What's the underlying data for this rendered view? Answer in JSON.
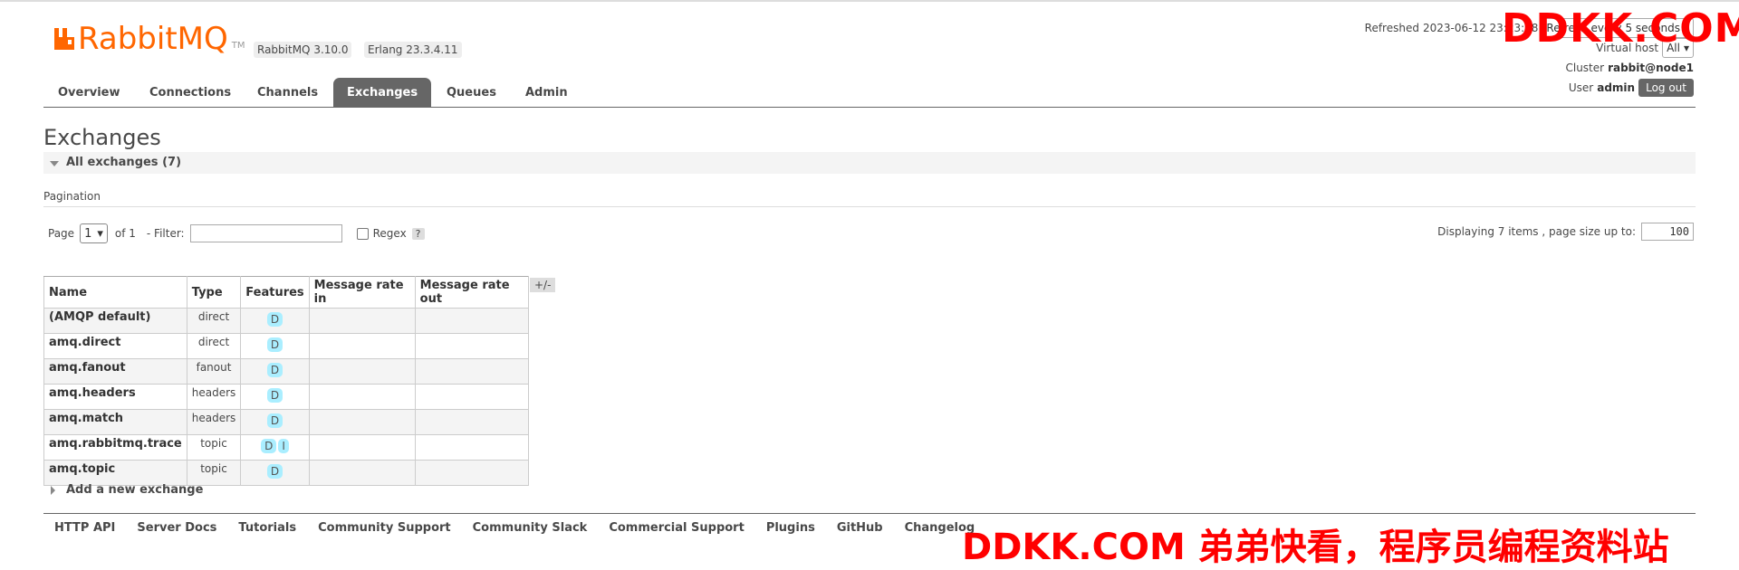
{
  "app": {
    "logo_text": "RabbitMQ",
    "logo_tm": "TM",
    "version_rabbit": "RabbitMQ 3.10.0",
    "version_erlang": "Erlang 23.3.4.11",
    "brand_color": "#ff6600"
  },
  "status": {
    "refreshed_label": "Refreshed",
    "refreshed_time": "2023-06-12 23:23:28",
    "refresh_every_text": "Refresh every",
    "refresh_interval": "5 seconds",
    "vhost_label": "Virtual host",
    "vhost_value": "All",
    "cluster_label": "Cluster",
    "cluster_value": "rabbit@node1",
    "user_label": "User",
    "user_value": "admin",
    "logout_label": "Log out"
  },
  "nav": {
    "tabs": [
      "Overview",
      "Connections",
      "Channels",
      "Exchanges",
      "Queues",
      "Admin"
    ],
    "active": "Exchanges"
  },
  "page": {
    "title": "Exchanges",
    "section_label": "All exchanges (7)"
  },
  "pagination": {
    "label": "Pagination",
    "page_label": "Page",
    "page_value": "1",
    "of_text": "of 1",
    "filter_label": "- Filter:",
    "filter_value": "",
    "regex_label": "Regex",
    "help": "?",
    "display_text": "Displaying 7 items , page size up to:",
    "page_size": "100"
  },
  "table": {
    "columns": [
      "Name",
      "Type",
      "Features",
      "Message rate in",
      "Message rate out"
    ],
    "toggle": "+/-",
    "rows": [
      {
        "name": "(AMQP default)",
        "type": "direct",
        "features": [
          "D"
        ],
        "rate_in": "",
        "rate_out": ""
      },
      {
        "name": "amq.direct",
        "type": "direct",
        "features": [
          "D"
        ],
        "rate_in": "",
        "rate_out": ""
      },
      {
        "name": "amq.fanout",
        "type": "fanout",
        "features": [
          "D"
        ],
        "rate_in": "",
        "rate_out": ""
      },
      {
        "name": "amq.headers",
        "type": "headers",
        "features": [
          "D"
        ],
        "rate_in": "",
        "rate_out": ""
      },
      {
        "name": "amq.match",
        "type": "headers",
        "features": [
          "D"
        ],
        "rate_in": "",
        "rate_out": ""
      },
      {
        "name": "amq.rabbitmq.trace",
        "type": "topic",
        "features": [
          "D",
          "I"
        ],
        "rate_in": "",
        "rate_out": ""
      },
      {
        "name": "amq.topic",
        "type": "topic",
        "features": [
          "D"
        ],
        "rate_in": "",
        "rate_out": ""
      }
    ]
  },
  "add_exchange_label": "Add a new exchange",
  "footer": {
    "links": [
      "HTTP API",
      "Server Docs",
      "Tutorials",
      "Community Support",
      "Community Slack",
      "Commercial Support",
      "Plugins",
      "GitHub",
      "Changelog"
    ]
  },
  "watermark": {
    "top": "DDKK.COM",
    "bottom": "DDKK.COM 弟弟快看，程序员编程资料站",
    "color": "#ff0000"
  }
}
